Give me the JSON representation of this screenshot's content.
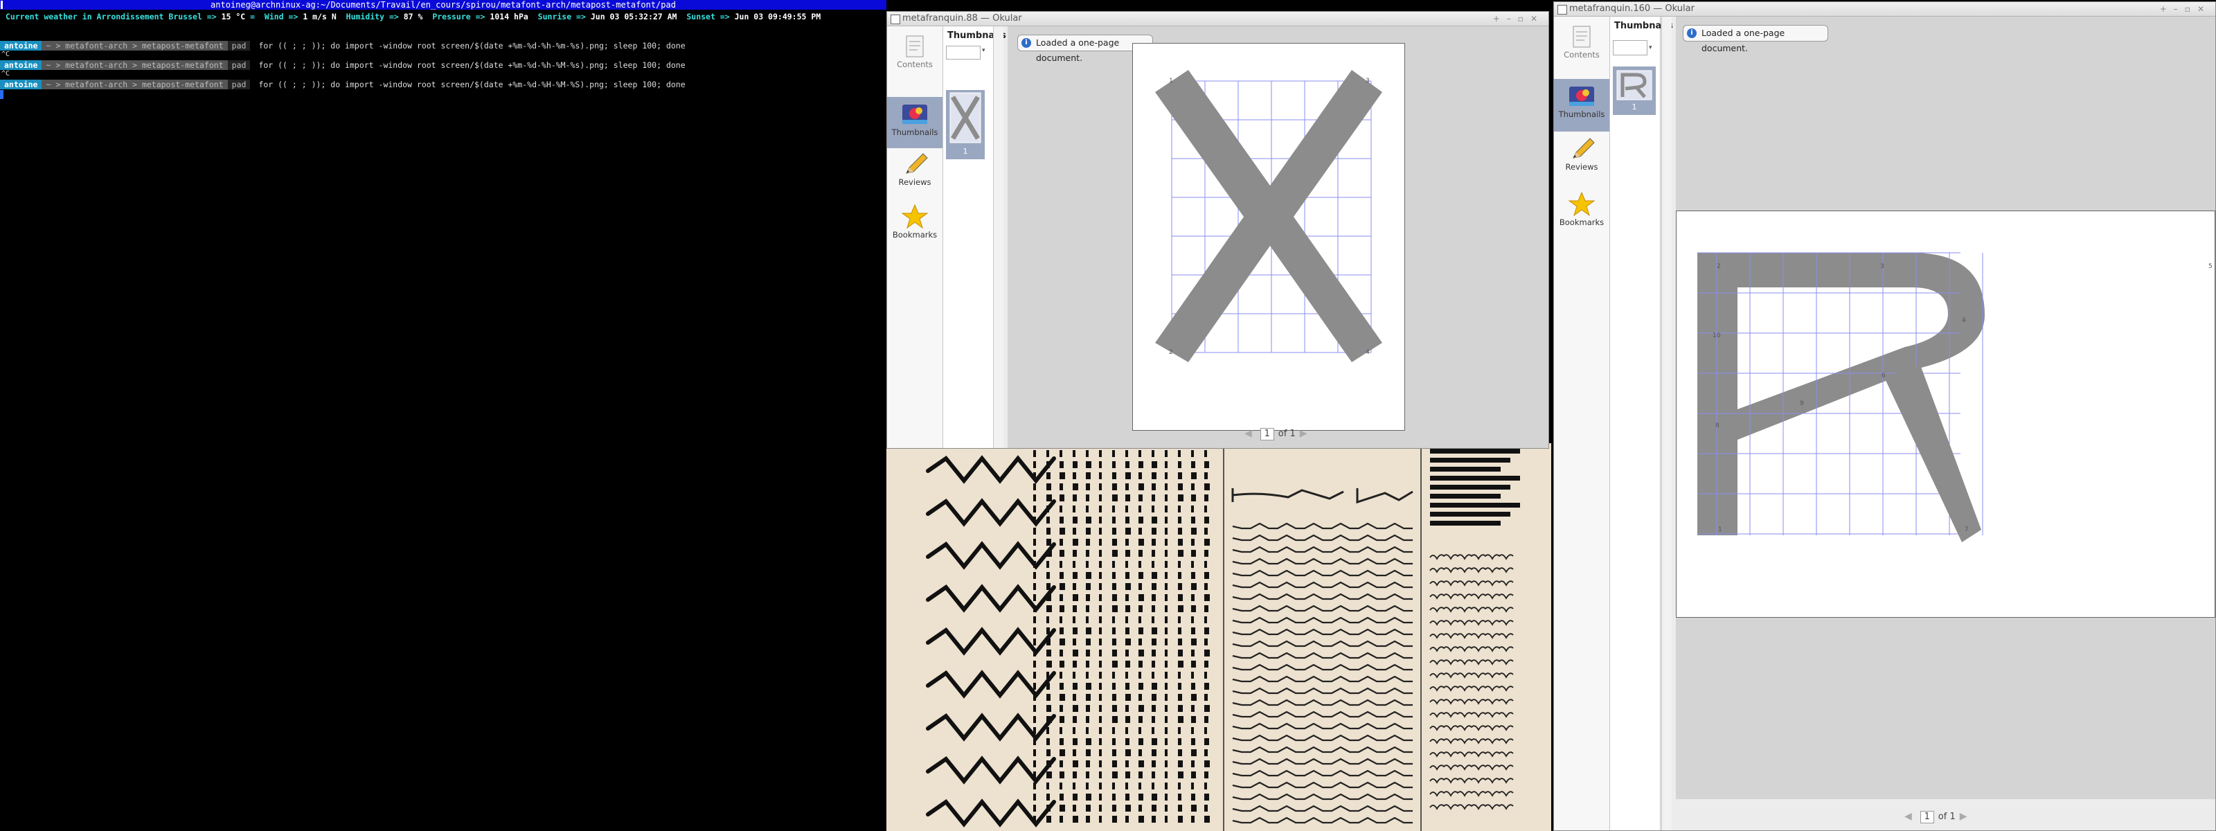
{
  "terminal": {
    "title": "antoineg@archninux-ag:~/Documents/Travail/en_cours/spirou/metafont-arch/metapost-metafont/pad",
    "weather": {
      "prefix": "Current weather in Arrondissement Brussel =>",
      "temp": "15 °C",
      "wind_label": "Wind =>",
      "wind": "1 m/s N",
      "humidity_label": "Humidity =>",
      "humidity": "87 %",
      "pressure_label": "Pressure =>",
      "pressure": "1014 hPa",
      "sunrise_label": "Sunrise =>",
      "sunrise": "Jun 03 05:32:27 AM",
      "sunset_label": "Sunset =>",
      "sunset": "Jun 03 09:49:55 PM"
    },
    "prompt": {
      "user": "antoine",
      "path": "~ > metafont-arch > metapost-metafont",
      "branch": "pad"
    },
    "commands": [
      "for (( ; ; )); do import -window root screen/$(date +%m-%d-%h-%m-%s).png; sleep 100; done",
      "for (( ; ; )); do import -window root screen/$(date +%m-%d-%h-%M-%s).png; sleep 100; done",
      "for (( ; ; )); do import -window root screen/$(date +%m-%d-%H-%M-%S).png; sleep 100; done"
    ],
    "interrupt_glyph": "^C"
  },
  "okular_left": {
    "title": "metafranquin.88 — Okular",
    "side_tabs": {
      "contents": "Contents",
      "thumbnails": "Thumbnails",
      "reviews": "Reviews",
      "bookmarks": "Bookmarks"
    },
    "panel_title": "Thumbnails",
    "thumb_page": "1",
    "notice": "Loaded a one-page document.",
    "pager": {
      "current": "1",
      "of_label": "of",
      "total": "1"
    },
    "glyph_corner_labels": {
      "tl": "1",
      "tr": "3",
      "bl": "2",
      "br": "4"
    }
  },
  "okular_right": {
    "title": "metafranquin.160 — Okular",
    "side_tabs": {
      "contents": "Contents",
      "thumbnails": "Thumbnails",
      "reviews": "Reviews",
      "bookmarks": "Bookmarks"
    },
    "panel_title": "Thumbnails",
    "thumb_page": "1",
    "notice": "Loaded a one-page document.",
    "pager": {
      "current": "1",
      "of_label": "of",
      "total": "1"
    },
    "glyph_point_labels": {
      "p1": "2",
      "p2": "3",
      "p3": "4",
      "p4": "5",
      "p5": "6",
      "p6": "8",
      "p7": "9",
      "p8": "10",
      "p9": "1",
      "p10": "7"
    }
  },
  "colors": {
    "terminal_title_bg": "#0a0ad8",
    "weather_text": "#38e0e0",
    "prompt_user_bg": "#1a8fbf",
    "glyph_fill": "#8c8c8c",
    "grid_line": "#8a8ef0",
    "active_tab": "#9aa7c0",
    "notice_icon": "#2e6dc9",
    "background_page": "#ede1cf"
  }
}
